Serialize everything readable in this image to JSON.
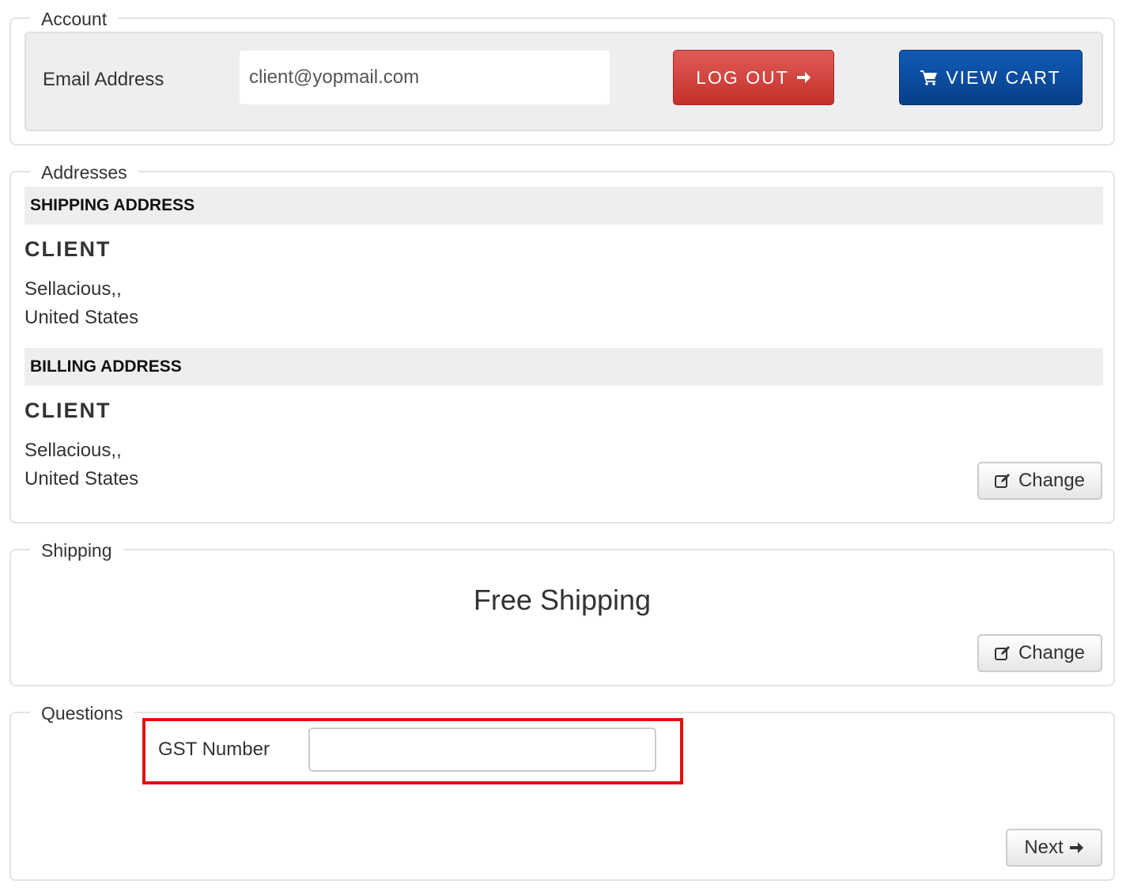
{
  "account": {
    "legend": "Account",
    "email_label": "Email Address",
    "email_value": "client@yopmail.com",
    "logout_label": "LOG OUT",
    "view_cart_label": "VIEW CART"
  },
  "addresses": {
    "legend": "Addresses",
    "shipping": {
      "header": "SHIPPING ADDRESS",
      "name": "CLIENT",
      "line1": "Sellacious,,",
      "line2": "United States"
    },
    "billing": {
      "header": "BILLING ADDRESS",
      "name": "CLIENT",
      "line1": "Sellacious,,",
      "line2": "United States"
    },
    "change_label": "Change"
  },
  "shipping": {
    "legend": "Shipping",
    "method": "Free Shipping",
    "change_label": "Change"
  },
  "questions": {
    "legend": "Questions",
    "gst_label": "GST Number",
    "gst_value": "",
    "next_label": "Next"
  },
  "colors": {
    "logout": "#d9534f",
    "view_cart": "#0a4a9f",
    "highlight": "#e31010"
  },
  "icons": {
    "arrow": "arrow-right-icon",
    "cart": "cart-icon",
    "edit": "edit-icon"
  }
}
